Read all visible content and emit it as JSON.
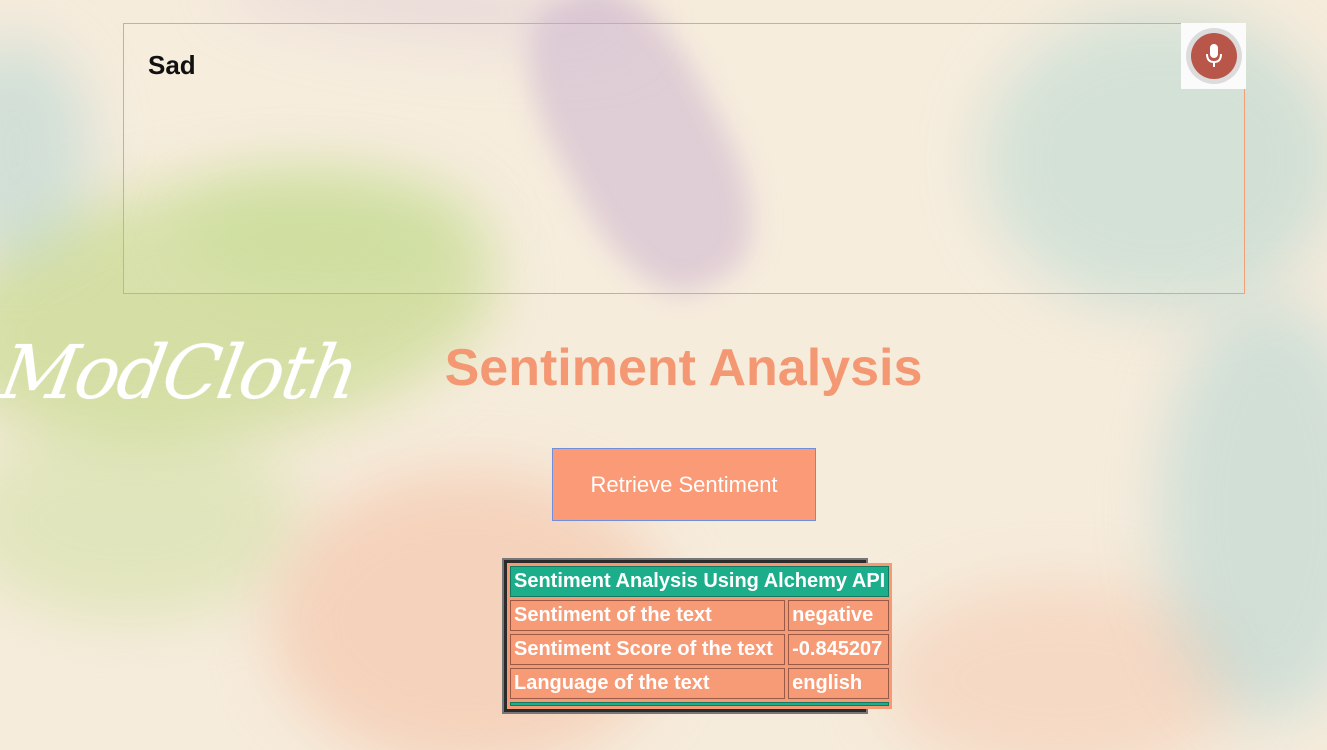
{
  "speech": {
    "text": "Sad"
  },
  "mic": {
    "icon": "microphone-icon"
  },
  "logo": {
    "text": "ModCloth"
  },
  "title": "Sentiment Analysis",
  "button": {
    "label": "Retrieve Sentiment"
  },
  "results": {
    "header": "Sentiment Analysis Using Alchemy API",
    "rows": [
      {
        "label": "Sentiment of the text",
        "value": "negative"
      },
      {
        "label": "Sentiment Score of the text",
        "value": "-0.845207"
      },
      {
        "label": "Language of the text",
        "value": "english"
      }
    ]
  },
  "colors": {
    "accent": "#f49874",
    "button": "#fb9a76",
    "table_header": "#1cae8a",
    "mic": "#b9564a"
  }
}
